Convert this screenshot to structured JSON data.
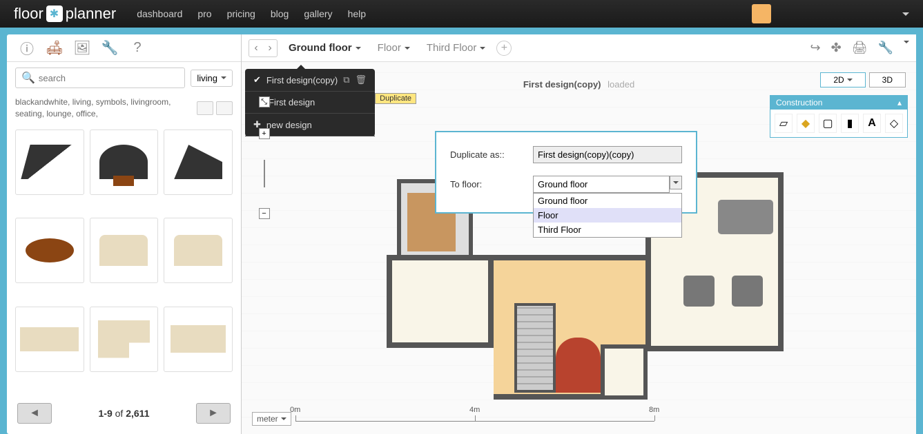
{
  "logo": {
    "text_left": "floor",
    "text_right": "planner"
  },
  "nav": [
    "dashboard",
    "pro",
    "pricing",
    "blog",
    "gallery",
    "help"
  ],
  "sidebar": {
    "search_placeholder": "search",
    "category": "living",
    "tags": "blackandwhite, living, symbols, livingroom, seating, lounge, office,",
    "page_range": "1-9",
    "page_of": "of",
    "page_total": "2,611"
  },
  "floors": {
    "tabs": [
      "Ground floor",
      "Floor",
      "Third Floor"
    ],
    "active": 0
  },
  "design_menu": {
    "items": [
      "First design(copy)",
      "First design",
      "new design"
    ],
    "selected": 0,
    "tooltip": "Duplicate"
  },
  "design_title": {
    "name": "First design(copy)",
    "status": "loaded"
  },
  "view_modes": [
    "2D",
    "3D"
  ],
  "construction": {
    "title": "Construction"
  },
  "dialog": {
    "label_name": "Duplicate as::",
    "value_name": "First design(copy)(copy)",
    "label_floor": "To floor:",
    "value_floor": "Ground floor",
    "options": [
      "Ground floor",
      "Floor",
      "Third Floor"
    ],
    "highlighted": 1
  },
  "ruler": {
    "unit": "meter",
    "marks": [
      "0m",
      "4m",
      "8m"
    ]
  }
}
